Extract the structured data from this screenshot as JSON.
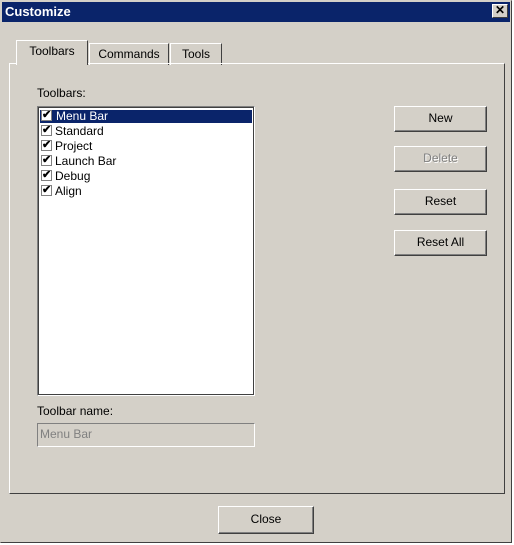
{
  "window": {
    "title": "Customize",
    "close_glyph": "✕"
  },
  "tabs": [
    {
      "label": "Toolbars",
      "active": true
    },
    {
      "label": "Commands",
      "active": false
    },
    {
      "label": "Tools",
      "active": false
    }
  ],
  "toolbars_label": "Toolbars:",
  "toolbars": [
    {
      "label": "Menu Bar",
      "checked": true,
      "selected": true
    },
    {
      "label": "Standard",
      "checked": true,
      "selected": false
    },
    {
      "label": "Project",
      "checked": true,
      "selected": false
    },
    {
      "label": "Launch Bar",
      "checked": true,
      "selected": false
    },
    {
      "label": "Debug",
      "checked": true,
      "selected": false
    },
    {
      "label": "Align",
      "checked": true,
      "selected": false
    }
  ],
  "check_glyph": "✔",
  "toolbar_name_label": "Toolbar name:",
  "toolbar_name_value": "Menu Bar",
  "buttons": {
    "new": "New",
    "delete": "Delete",
    "reset": "Reset",
    "reset_all": "Reset All",
    "close": "Close"
  },
  "colors": {
    "title_bar": "#0a246a",
    "face": "#d4d0c8",
    "selection": "#0a246a"
  }
}
